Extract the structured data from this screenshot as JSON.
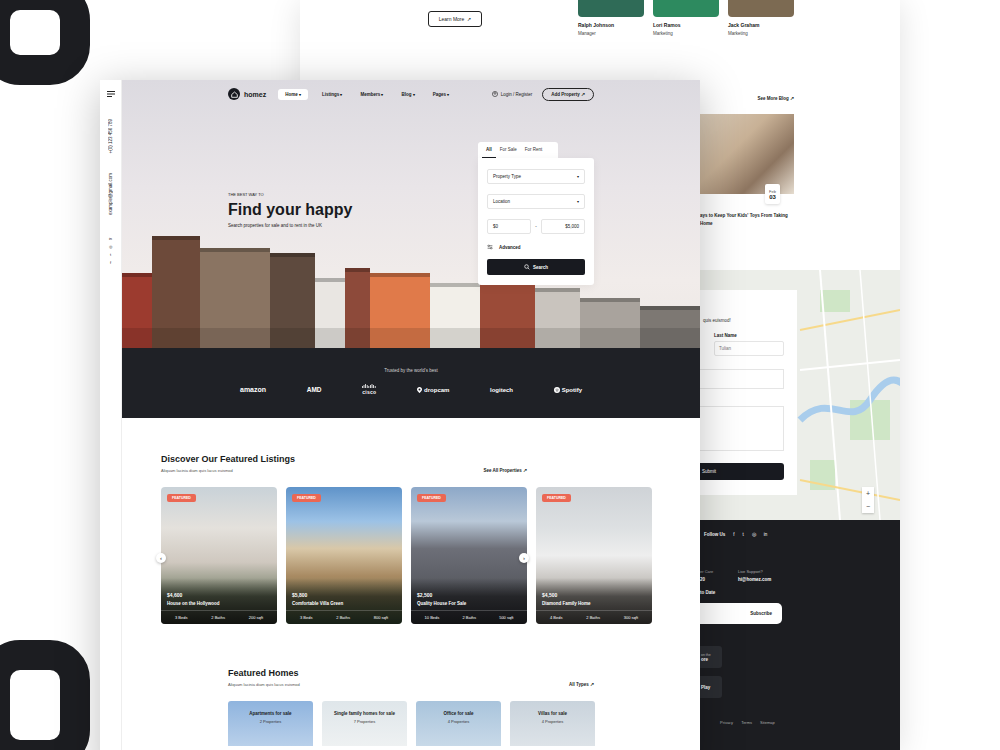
{
  "back_page": {
    "about": {
      "button": "Learn More",
      "button_icon": "↗"
    },
    "team": [
      {
        "name": "Ralph Johnson",
        "role": "Manager"
      },
      {
        "name": "Lori Ramos",
        "role": "Marketing"
      },
      {
        "name": "Jack Graham",
        "role": "Marketing"
      }
    ],
    "blog": {
      "link": "See More Blog",
      "link_icon": "↗",
      "date_month": "Feb",
      "date_day": "03",
      "title_lines": [
        "ays to Keep Your Kids' Toys From Taking",
        "Home"
      ]
    },
    "contact": {
      "intro": "quis euismod!",
      "last_name_label": "Last Name",
      "last_name_value": "Tulian",
      "submit": "Submit",
      "zoom_in": "+",
      "zoom_out": "−"
    },
    "footer": {
      "follow": "Follow Us",
      "social": [
        "f",
        "t",
        "◎",
        "in"
      ],
      "support_label": "er Care",
      "support_value": "20",
      "live_label": "Live Support?",
      "live_value": "hi@homez.com",
      "newsletter": "to Date",
      "subscribe": "Subscribe",
      "apps": [
        {
          "small": "on the",
          "big": "ore"
        },
        {
          "small": "",
          "big": "Play"
        }
      ],
      "links": [
        "Privacy",
        "Terms",
        "Sitemap"
      ]
    }
  },
  "front_page": {
    "sidebar": {
      "phone": "+(0) 123 456 789",
      "email": "example@gmail.com",
      "social": [
        "in",
        "◎",
        "t",
        "f"
      ]
    },
    "nav": {
      "logo": "homez",
      "caret": "▾",
      "items": [
        {
          "label": "Home",
          "selected": true
        },
        {
          "label": "Listings",
          "selected": false
        },
        {
          "label": "Members",
          "selected": false
        },
        {
          "label": "Blog",
          "selected": false
        },
        {
          "label": "Pages",
          "selected": false
        }
      ],
      "login": "Login / Register",
      "add_property": "Add Property",
      "add_icon": "↗"
    },
    "hero": {
      "eyebrow": "THE BEST WAY TO",
      "title": "Find your happy",
      "subtitle": "Search properties for sale and to rent in the UK"
    },
    "search": {
      "tabs": [
        {
          "label": "All",
          "selected": true
        },
        {
          "label": "For Sale",
          "selected": false
        },
        {
          "label": "For Rent",
          "selected": false
        }
      ],
      "fields": [
        "Property Type",
        "Location"
      ],
      "caret": "▾",
      "price_min": "$0",
      "price_sep": "-",
      "price_max": "$5,000",
      "advanced": "Advanced",
      "button": "Search"
    },
    "brands": {
      "title": "Trusted by the world's best",
      "logos": [
        "amazon",
        "AMD",
        "cisco",
        "dropcam",
        "logitech",
        "Spotify"
      ]
    },
    "listings": {
      "title": "Discover Our Featured Listings",
      "subtitle": "Aliquam lacinia diam quis lacus euismod",
      "link": "See All Properties",
      "link_icon": "↗",
      "prev": "‹",
      "next": "›",
      "items": [
        {
          "badge": "FEATURED",
          "price": "$4,600",
          "title": "House on the Hollywood",
          "facts": [
            "3 Beds",
            "2 Baths",
            "200 sqft"
          ]
        },
        {
          "badge": "FEATURED",
          "price": "$5,800",
          "title": "Comfortable Villa Green",
          "facts": [
            "3 Beds",
            "2 Baths",
            "800 sqft"
          ]
        },
        {
          "badge": "FEATURED",
          "price": "$2,500",
          "title": "Quality House For Sale",
          "facts": [
            "10 Beds",
            "2 Baths",
            "500 sqft"
          ]
        },
        {
          "badge": "FEATURED",
          "price": "$4,500",
          "title": "Diamond Family Home",
          "facts": [
            "4 Beds",
            "2 Baths",
            "300 sqft"
          ]
        }
      ]
    },
    "homes": {
      "title": "Featured Homes",
      "subtitle": "Aliquam lacinia diam quis lacus euismod",
      "link": "All Types",
      "link_icon": "↗",
      "categories": [
        {
          "title": "Apartments for sale",
          "count": "2 Properties"
        },
        {
          "title": "Single family homes for sale",
          "count": "7 Properties"
        },
        {
          "title": "Office for sale",
          "count": "4 Properties"
        },
        {
          "title": "Villas for sale",
          "count": "4 Properties"
        }
      ]
    }
  }
}
